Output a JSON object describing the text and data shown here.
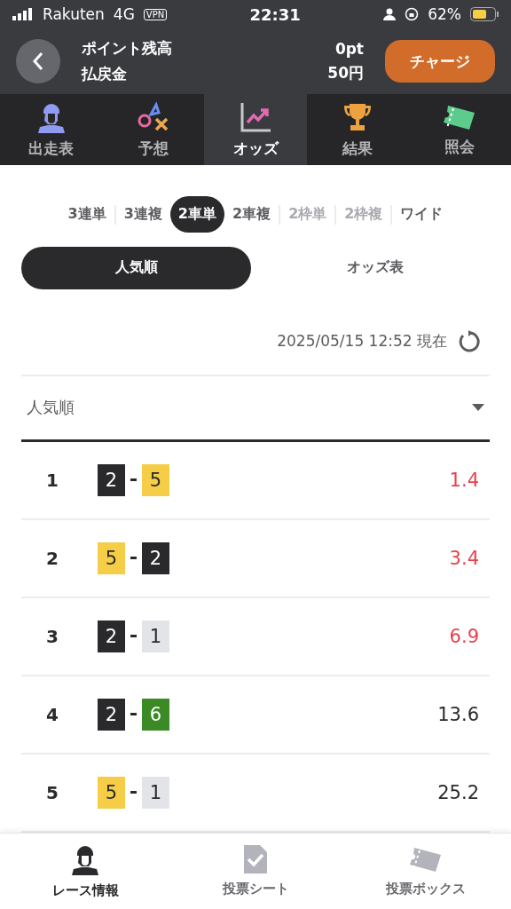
{
  "status_bar": {
    "carrier": "Rakuten",
    "network": "4G",
    "vpn": "VPN",
    "time": "22:31",
    "battery": "62%"
  },
  "header": {
    "labels": [
      "ポイント残高",
      "払戻金"
    ],
    "values": [
      "0pt",
      "50円"
    ],
    "charge_button": "チャージ"
  },
  "tabs": [
    {
      "label": "出走表",
      "kind": "rider",
      "selected": false
    },
    {
      "label": "予想",
      "kind": "marks",
      "selected": false
    },
    {
      "label": "オッズ",
      "kind": "chart",
      "selected": true
    },
    {
      "label": "結果",
      "kind": "trophy",
      "selected": false
    },
    {
      "label": "照会",
      "kind": "ticket",
      "selected": false
    }
  ],
  "bet_types": [
    {
      "label": "3連単",
      "selected": false,
      "disabled": false
    },
    {
      "label": "3連複",
      "selected": false,
      "disabled": false
    },
    {
      "label": "2車単",
      "selected": true,
      "disabled": false
    },
    {
      "label": "2車複",
      "selected": false,
      "disabled": false
    },
    {
      "label": "2枠単",
      "selected": false,
      "disabled": true
    },
    {
      "label": "2枠複",
      "selected": false,
      "disabled": true
    },
    {
      "label": "ワイド",
      "selected": false,
      "disabled": false
    }
  ],
  "view_toggle": [
    {
      "label": "人気順",
      "selected": true
    },
    {
      "label": "オッズ表",
      "selected": false
    }
  ],
  "timestamp": "2025/05/15 12:52 現在",
  "sort_select": {
    "value": "人気順"
  },
  "rows": [
    {
      "rank": "1",
      "first": {
        "number": "2",
        "color": "#2a2a2c"
      },
      "second": {
        "number": "5",
        "color": "#f5cd47"
      },
      "odds": "1.4",
      "highlighted": true
    },
    {
      "rank": "2",
      "first": {
        "number": "5",
        "color": "#f5cd47"
      },
      "second": {
        "number": "2",
        "color": "#2a2a2c"
      },
      "odds": "3.4",
      "highlighted": true
    },
    {
      "rank": "3",
      "first": {
        "number": "2",
        "color": "#2a2a2c"
      },
      "second": {
        "number": "1",
        "color": "#e3e4e8"
      },
      "odds": "6.9",
      "highlighted": true
    },
    {
      "rank": "4",
      "first": {
        "number": "2",
        "color": "#2a2a2c"
      },
      "second": {
        "number": "6",
        "color": "#3c8a25"
      },
      "odds": "13.6",
      "highlighted": false
    },
    {
      "rank": "5",
      "first": {
        "number": "5",
        "color": "#f5cd47"
      },
      "second": {
        "number": "1",
        "color": "#e3e4e8"
      },
      "odds": "25.2",
      "highlighted": false
    }
  ],
  "bottom_nav": [
    {
      "label": "レース情報",
      "kind": "rider",
      "selected": true
    },
    {
      "label": "投票シート",
      "kind": "sheet",
      "selected": false
    },
    {
      "label": "投票ボックス",
      "kind": "ticket",
      "selected": false
    }
  ]
}
